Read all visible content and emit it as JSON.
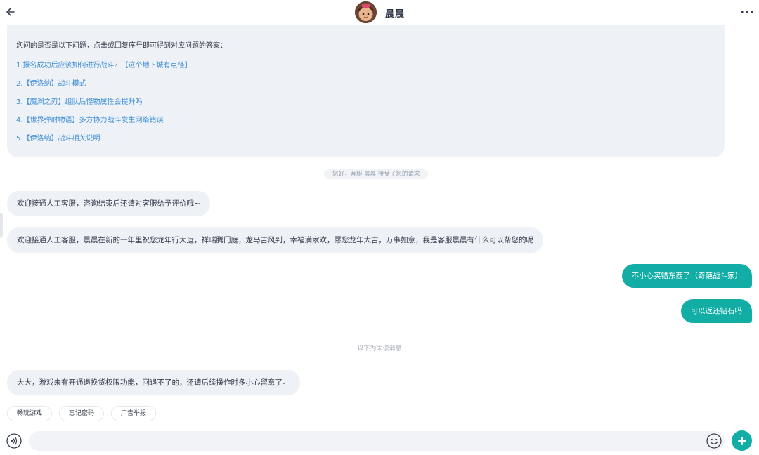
{
  "header": {
    "back_icon": "arrow-left-icon",
    "agent_name": "晨晨",
    "more_icon": "more-horizontal-icon"
  },
  "faq": {
    "intro": "您问的是否是以下问题，点击或回复序号即可得到对应问题的答案：",
    "items": [
      "1.报名成功后应该如何进行战斗？【这个地下城有点怪】",
      "2.【伊洛纳】战斗模式",
      "3.【魔渊之刃】组队后怪物属性会提升吗",
      "4.【世界弹射物语】多方协力战斗发生网络错误",
      "5.【伊洛纳】战斗相关说明"
    ]
  },
  "system_note": "您好，客服 晨晨 接受了您的请求",
  "messages_in": [
    "欢迎接通人工客服，咨询结束后还请对客服给予评价哦~",
    "欢迎接通人工客服，晨晨在新的一年里祝您龙年行大运，祥瑞腾门庭，龙马吉风到，幸福满家欢，愿您龙年大吉，万事如意，我是客服晨晨有什么可以帮您的呢"
  ],
  "messages_out": [
    "不小心买错东西了（奇葩战斗家）",
    "可以返还钻石吗"
  ],
  "unread_divider": "以下为未读消息",
  "last_message": "大大，游戏未有开通退换货权限功能，回退不了的，还请后续操作时多小心留意了。",
  "quick_replies": [
    "畅玩游戏",
    "忘记密码",
    "广告举报"
  ],
  "composer": {
    "placeholder": "",
    "voice_icon": "voice-icon",
    "emoji_icon": "emoji-icon",
    "plus_icon": "plus-icon"
  },
  "colors": {
    "accent": "#12aea6",
    "link": "#3d8ed6",
    "bubble_bg": "#eef1f6"
  }
}
